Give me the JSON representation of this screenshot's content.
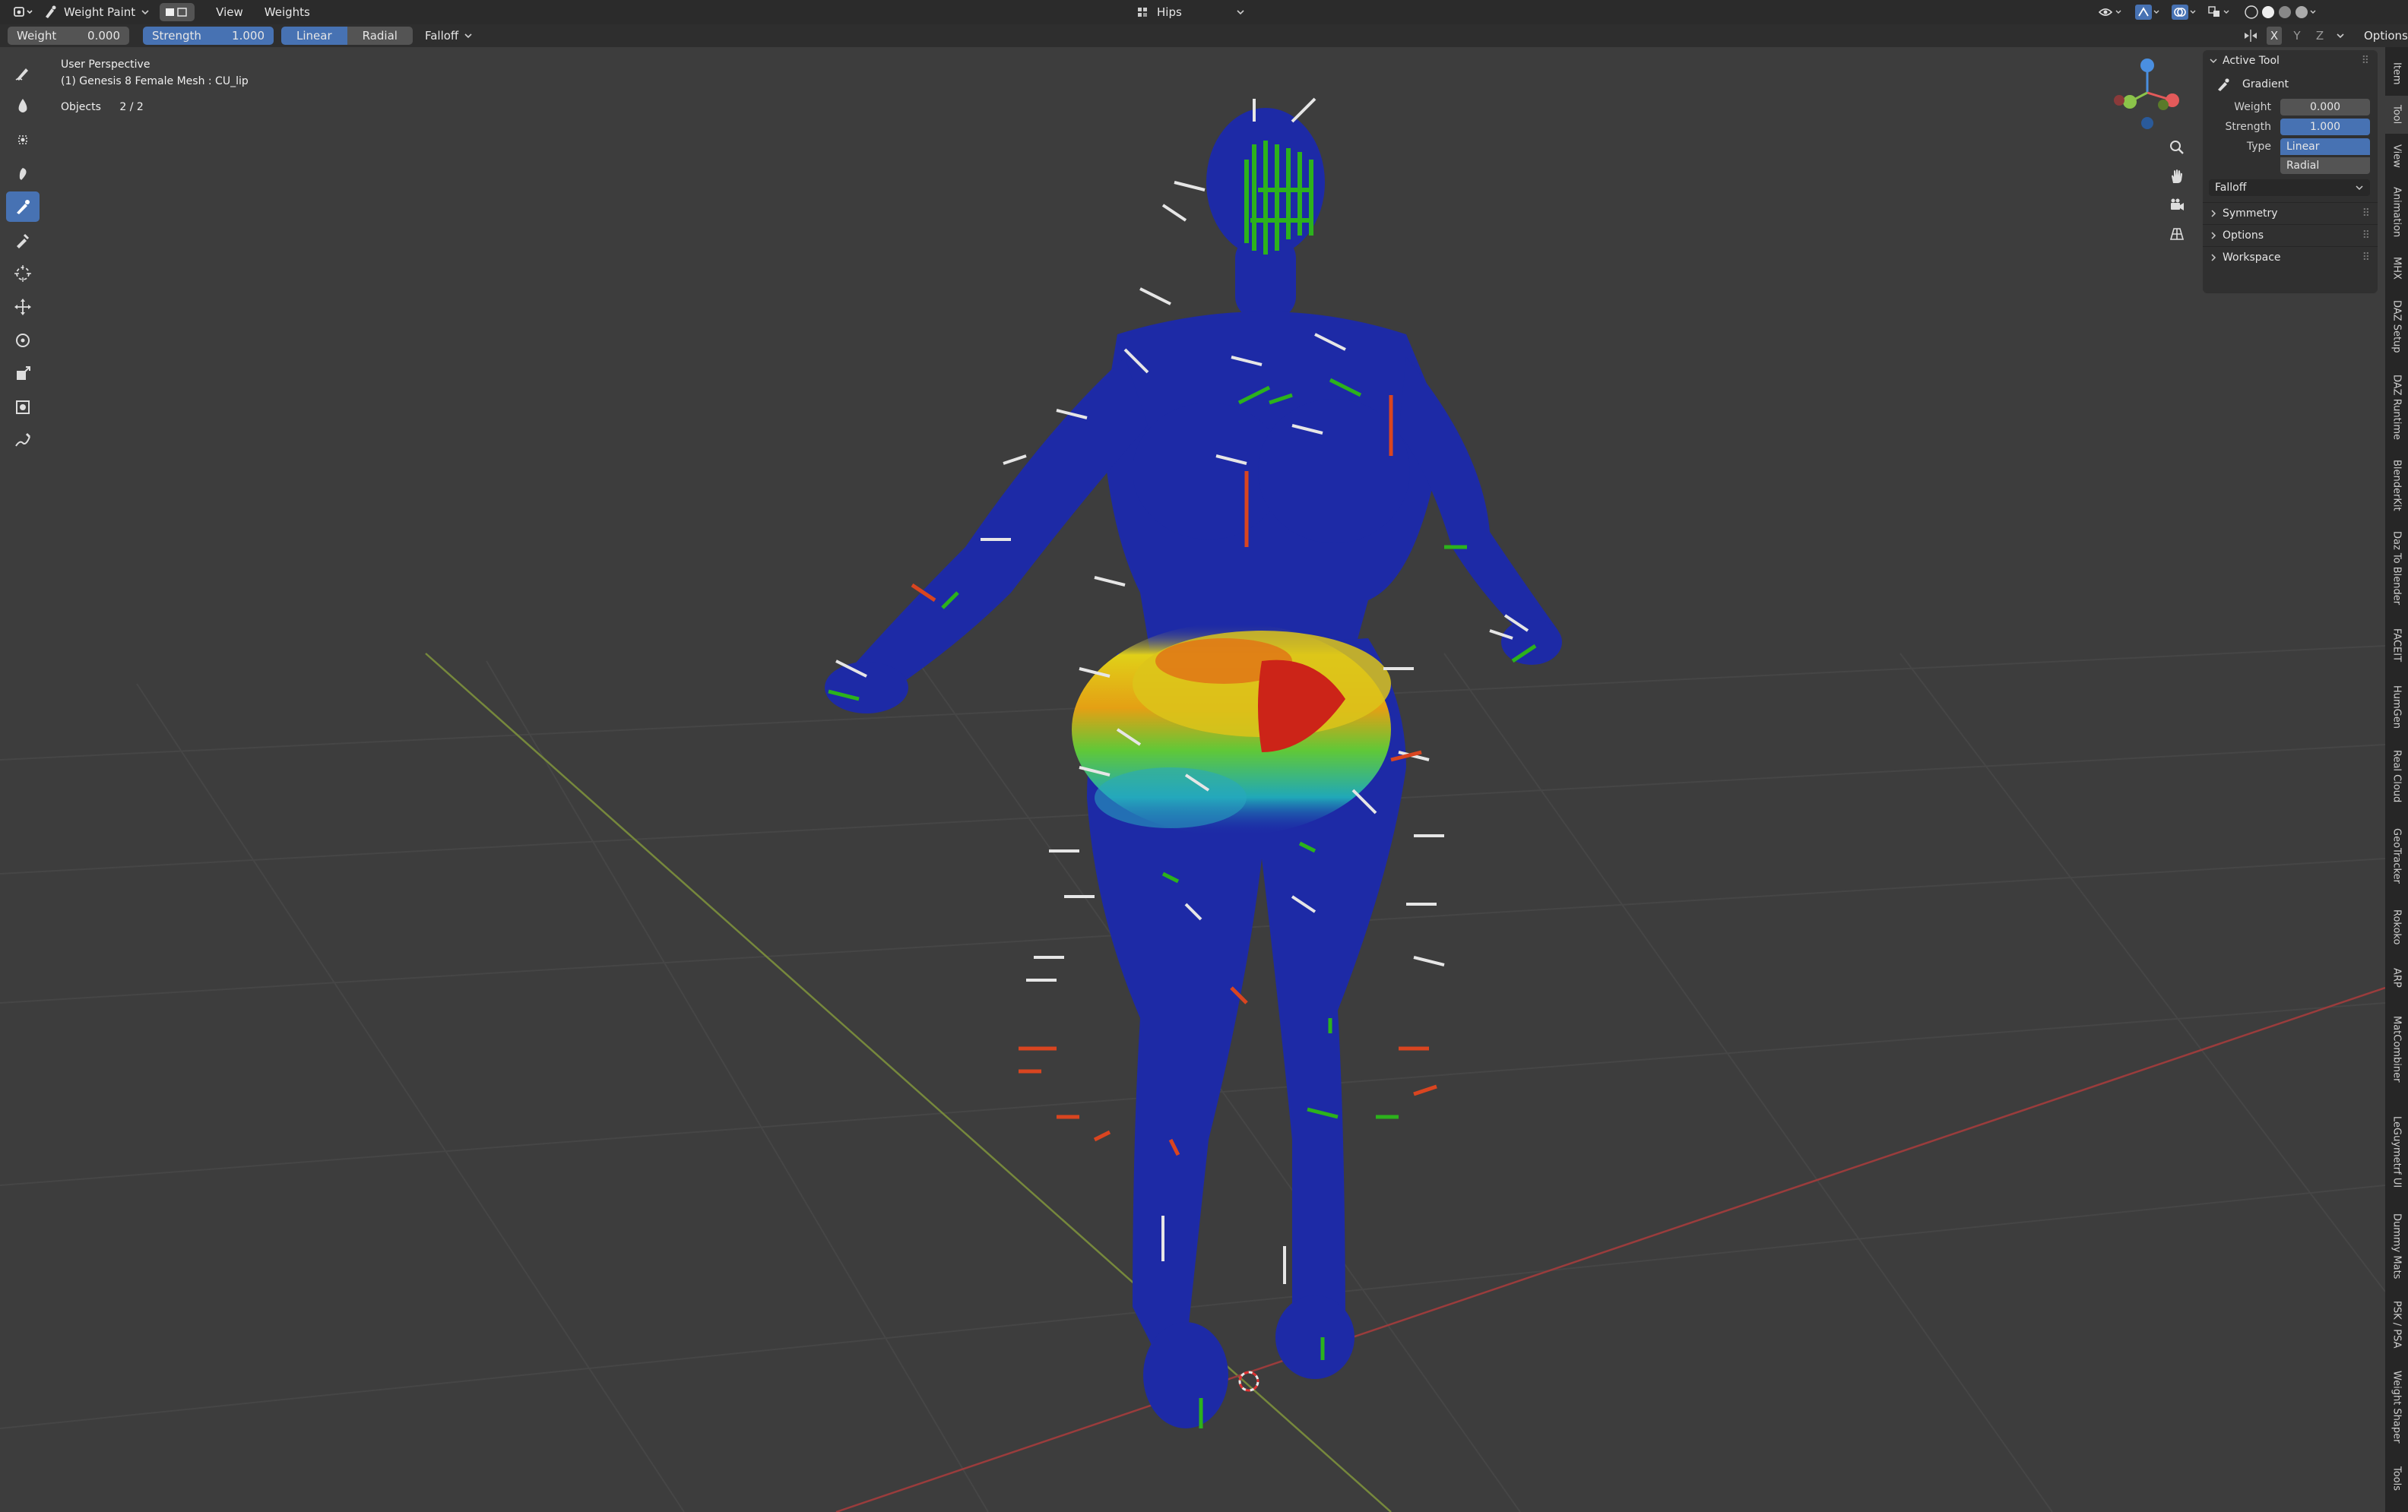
{
  "header": {
    "mode": "Weight Paint",
    "menus": [
      "View",
      "Weights"
    ],
    "bone": "Hips",
    "options": "Options",
    "axes": [
      "X",
      "Y",
      "Z"
    ]
  },
  "toolheader": {
    "weight_label": "Weight",
    "weight_value": "0.000",
    "strength_label": "Strength",
    "strength_value": "1.000",
    "type_options": [
      "Linear",
      "Radial"
    ],
    "type_selected": "Linear",
    "falloff": "Falloff"
  },
  "overlay": {
    "perspective": "User Perspective",
    "object": "(1) Genesis 8 Female Mesh : CU_lip",
    "objects_label": "Objects",
    "objects_value": "2 / 2"
  },
  "toolbar": {
    "tools": [
      "draw-tool-icon",
      "blur-tool-icon",
      "average-tool-icon",
      "smear-tool-icon",
      "gradient-tool-icon",
      "sample-weight-icon",
      "cursor-icon",
      "move-icon",
      "rotate-icon",
      "scale-icon",
      "transform-icon",
      "annotate-icon"
    ],
    "active": "gradient-tool-icon"
  },
  "sidebar": {
    "active_tool_title": "Active Tool",
    "tool_name": "Gradient",
    "weight_label": "Weight",
    "weight_value": "0.000",
    "strength_label": "Strength",
    "strength_value": "1.000",
    "type_label": "Type",
    "type_linear": "Linear",
    "type_radial": "Radial",
    "falloff": "Falloff",
    "panels": [
      "Symmetry",
      "Options",
      "Workspace"
    ]
  },
  "tabs": [
    "Item",
    "Tool",
    "View",
    "Animation",
    "MHX",
    "DAZ Setup",
    "DAZ Runtime",
    "BlenderKit",
    "Daz To Blender",
    "FACEIT",
    "HumGen",
    "Real Cloud",
    "GeoTracker",
    "Rokoko",
    "ARP",
    "MatCombiner",
    "LeGuymetrf UI",
    "Dummy Mats",
    "PSK / PSA",
    "Weight Shaper",
    "Tools"
  ],
  "gizmo": {
    "x_color": "#e35a5a",
    "y_color": "#8bc34a",
    "z_color": "#4a8fe0"
  },
  "colors": {
    "accent": "#4772b3",
    "mesh": "#1d2aa6"
  }
}
